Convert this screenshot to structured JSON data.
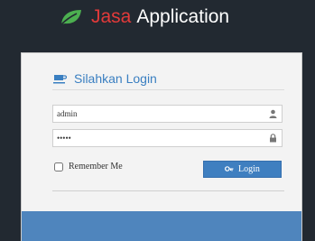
{
  "header": {
    "brand_part1": "Jasa",
    "brand_part2": "Application",
    "brand_icon": "leaf-icon"
  },
  "login_panel": {
    "title": "Silahkan Login",
    "title_icon": "coffee-cup-icon",
    "username": {
      "value": "admin",
      "icon": "user-icon"
    },
    "password": {
      "value": "•••••",
      "icon": "lock-icon"
    },
    "remember_label": "Remember Me",
    "remember_checked": false,
    "login_label": "Login",
    "login_icon": "key-icon"
  },
  "colors": {
    "background": "#222931",
    "brand_red": "#e23a3a",
    "brand_leaf": "#4caf50",
    "accent_blue": "#3f7fc0",
    "panel": "#f3f3f3"
  }
}
